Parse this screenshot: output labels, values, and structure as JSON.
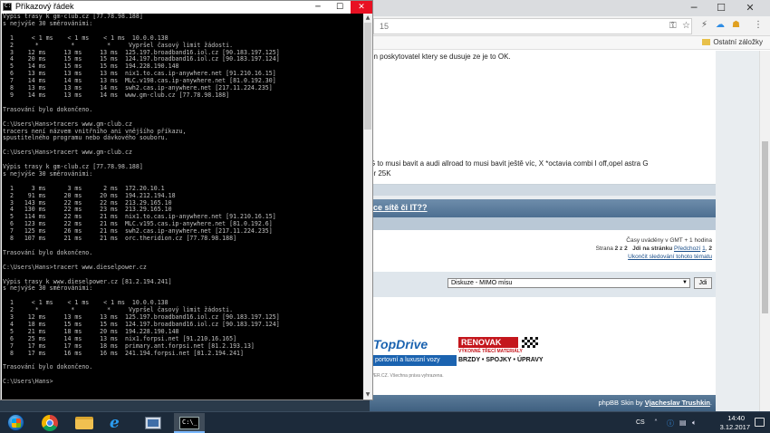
{
  "cmd": {
    "title": "Příkazový řádek",
    "icon_glyph": "C:\\",
    "lines": [
      "Výpis trasy k gm-club.cz [77.78.98.188]",
      "s nejvýše 30 směrováními:",
      "",
      "  1     < 1 ms    < 1 ms    < 1 ms  10.0.0.138",
      "  2      *         *         *     Vypršel časový limit žádosti.",
      "  3    12 ms     13 ms     13 ms  125.197.broadband16.iol.cz [90.183.197.125]",
      "  4    20 ms     15 ms     15 ms  124.197.broadband16.iol.cz [90.183.197.124]",
      "  5    14 ms     15 ms     15 ms  194.228.190.148",
      "  6    13 ms     13 ms     13 ms  nix1.to.cas.ip-anywhere.net [91.210.16.15]",
      "  7    14 ms     14 ms     13 ms  MLC.v198.cas.ip-anywhere.net [81.0.192.30]",
      "  8    13 ms     13 ms     14 ms  swh2.cas.ip-anywhere.net [217.11.224.235]",
      "  9    14 ms     13 ms     14 ms  www.gm-club.cz [77.78.98.188]",
      "",
      "Trasování bylo dokončeno.",
      "",
      "C:\\Users\\Hans>tracers www.gm-club.cz",
      "tracers není názvem vnitřního ani vnějšího příkazu,",
      "spustitelného programu nebo dávkového souboru.",
      "",
      "C:\\Users\\Hans>tracert www.gm-club.cz",
      "",
      "Výpis trasy k gm-club.cz [77.78.98.188]",
      "s nejvýše 30 směrováními:",
      "",
      "  1     3 ms      3 ms      2 ms  172.20.10.1",
      "  2    91 ms     20 ms     20 ms  194.212.194.18",
      "  3   143 ms     22 ms     22 ms  213.29.165.10",
      "  4   130 ms     22 ms     23 ms  213.29.165.10",
      "  5   114 ms     22 ms     21 ms  nix1.to.cas.ip-anywhere.net [91.210.16.15]",
      "  6   123 ms     22 ms     21 ms  MLC.v195.cas.ip-anywhere.net [81.0.192.6]",
      "  7   125 ms     26 ms     21 ms  swh2.cas.ip-anywhere.net [217.11.224.235]",
      "  8   107 ms     21 ms     21 ms  orc.theridion.cz [77.78.98.188]",
      "",
      "Trasování bylo dokončeno.",
      "",
      "C:\\Users\\Hans>tracert www.dieselpower.cz",
      "",
      "Výpis trasy k www.dieselpower.cz [81.2.194.241]",
      "s nejvýše 30 směrováními:",
      "",
      "  1     < 1 ms    < 1 ms    < 1 ms  10.0.0.138",
      "  2      *         *         *     Vypršel časový limit žádosti.",
      "  3    12 ms     13 ms     13 ms  125.197.broadband16.iol.cz [90.183.197.125]",
      "  4    18 ms     15 ms     15 ms  124.197.broadband16.iol.cz [90.183.197.124]",
      "  5    21 ms     18 ms     20 ms  194.228.190.148",
      "  6    25 ms     14 ms     13 ms  nix1.forpsi.net [91.210.16.165]",
      "  7    17 ms     17 ms     18 ms  primary.ant.forpsi.net [81.2.193.13]",
      "  8    17 ms     16 ms     16 ms  241.194.forpsi.net [81.2.194.241]",
      "",
      "Trasování bylo dokončeno.",
      "",
      "C:\\Users\\Hans>"
    ]
  },
  "browser": {
    "url_fragment": "15",
    "bookmark_folder": "Ostatní záložky",
    "post_text_1": "en poskytovatel ktery se dusuje ze je to OK.",
    "post_text_2": "G to musi bavit a audi allroad to musi bavit ještě víc, X *octavia combi I off,opel astra G",
    "post_text_3": "or 25K",
    "topic_link": "ce sítě či IT??",
    "timezone_note": "Časy uváděny v GMT + 1 hodina",
    "page_label": "Strana",
    "page_numbers": "2 z 2",
    "goto_page_label": "Jdi na stránku",
    "prev_link": "Předchozí",
    "page_link_1": "1",
    "page_current": "2",
    "unsubscribe_link": "Ukončit sledování tohoto tématu",
    "jump_select_value": "Diskuze - MIMO mísu",
    "jump_button": "Jdi",
    "banner1_logo": "TopDrive",
    "banner1_tag": "portovní a luxusní vozy",
    "banner2_logo": "RENOVAK",
    "banner2_sub": "VÝKONNÉ TŘECÍ MATERIÁLY",
    "banner2_tag": "BRZDY • SPOJKY • ÚPRAVY",
    "copyright": "WER.CZ. Všechna práva vyhrazena.",
    "skin_credit_prefix": "phpBB Skin by",
    "skin_credit_author": "Vjacheslav Trushkin"
  },
  "taskbar": {
    "language": "CS",
    "time": "14:40",
    "date": "3.12.2017"
  }
}
